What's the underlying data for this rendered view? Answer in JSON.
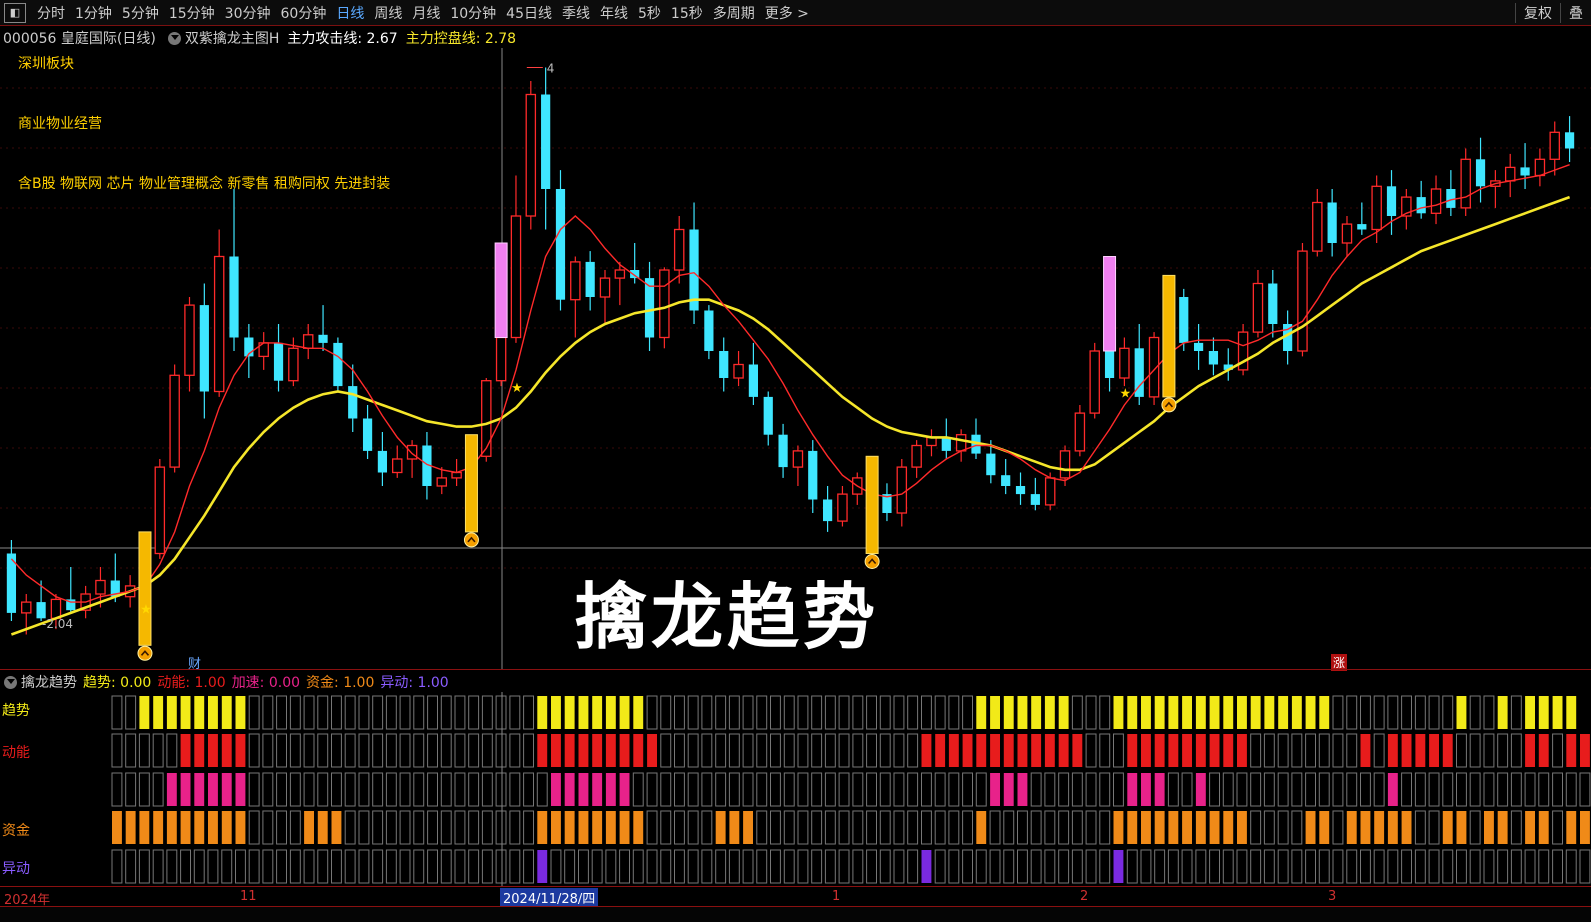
{
  "tabs": {
    "items": [
      "分时",
      "1分钟",
      "5分钟",
      "15分钟",
      "30分钟",
      "60分钟",
      "日线",
      "周线",
      "月线",
      "10分钟",
      "45日线",
      "季线",
      "年线",
      "5秒",
      "15秒",
      "多周期",
      "更多 >"
    ],
    "active_index": 6,
    "right": [
      "复权",
      "叠"
    ]
  },
  "info": {
    "stock": "000056 皇庭国际(日线)",
    "indicator": "双紫擒龙主图H",
    "attack_label": "主力攻击线: 2.67",
    "control_label": "主力控盘线: 2.78"
  },
  "boards": {
    "region": "深圳板块",
    "industry": "商业物业经营",
    "concepts": "含B股 物联网 芯片 物业管理概念 新零售 租购同权 先进封装"
  },
  "chart_labels": {
    "title": "擒龙趋势",
    "high_label": "4",
    "low_label": "-2.04",
    "cai_marker": "财",
    "zhang_marker": "涨"
  },
  "indicator_bar": {
    "name": "擒龙趋势",
    "trend": "趋势: 0.00",
    "momentum": "动能: 1.00",
    "accel": "加速: 0.00",
    "capital": "资金: 1.00",
    "anomaly": "异动: 1.00"
  },
  "rows": {
    "trend": "趋势",
    "momentum": "动能",
    "capital": "资金",
    "anomaly": "异动"
  },
  "dates": {
    "year": "2024年",
    "m11": "11",
    "current": "2024/11/28/四",
    "m1": "1",
    "m2": "2",
    "m3": "3"
  },
  "colors": {
    "up": "#ff2a2a",
    "down": "#3fe6ff",
    "ma_fast": "#ff2a2a",
    "ma_slow": "#f5e62a",
    "trend": "#f2ea18",
    "momentum": "#e81c1c",
    "accel": "#e8228a",
    "capital": "#f08a18",
    "anomaly": "#7a2ae0"
  },
  "chart_data": {
    "type": "candlestick",
    "candles": [
      [
        2.2,
        2.25,
        1.95,
        1.98
      ],
      [
        1.98,
        2.05,
        1.9,
        2.02
      ],
      [
        2.02,
        2.1,
        1.95,
        1.96
      ],
      [
        1.96,
        2.05,
        1.92,
        2.03
      ],
      [
        2.03,
        2.15,
        1.98,
        1.99
      ],
      [
        1.99,
        2.08,
        1.96,
        2.05
      ],
      [
        2.05,
        2.15,
        2.0,
        2.1
      ],
      [
        2.1,
        2.2,
        2.02,
        2.04
      ],
      [
        2.04,
        2.12,
        2.0,
        2.08
      ],
      [
        2.08,
        2.25,
        2.05,
        2.2
      ],
      [
        2.2,
        2.55,
        2.18,
        2.52
      ],
      [
        2.52,
        2.9,
        2.5,
        2.86
      ],
      [
        2.86,
        3.15,
        2.8,
        3.12
      ],
      [
        3.12,
        3.2,
        2.7,
        2.8
      ],
      [
        2.8,
        3.4,
        2.78,
        3.3
      ],
      [
        3.3,
        3.55,
        2.95,
        3.0
      ],
      [
        3.0,
        3.05,
        2.85,
        2.93
      ],
      [
        2.93,
        3.02,
        2.88,
        2.98
      ],
      [
        2.98,
        3.05,
        2.8,
        2.84
      ],
      [
        2.84,
        3.0,
        2.82,
        2.96
      ],
      [
        2.96,
        3.05,
        2.92,
        3.01
      ],
      [
        3.01,
        3.12,
        2.95,
        2.98
      ],
      [
        2.98,
        3.0,
        2.8,
        2.82
      ],
      [
        2.82,
        2.9,
        2.65,
        2.7
      ],
      [
        2.7,
        2.75,
        2.55,
        2.58
      ],
      [
        2.58,
        2.65,
        2.45,
        2.5
      ],
      [
        2.5,
        2.6,
        2.48,
        2.55
      ],
      [
        2.55,
        2.62,
        2.48,
        2.6
      ],
      [
        2.6,
        2.65,
        2.4,
        2.45
      ],
      [
        2.45,
        2.52,
        2.42,
        2.48
      ],
      [
        2.48,
        2.55,
        2.45,
        2.5
      ],
      [
        2.5,
        2.62,
        2.48,
        2.56
      ],
      [
        2.56,
        2.85,
        2.54,
        2.84
      ],
      [
        2.84,
        3.05,
        2.82,
        3.0
      ],
      [
        3.0,
        3.6,
        2.98,
        3.45
      ],
      [
        3.45,
        3.95,
        3.4,
        3.9
      ],
      [
        3.9,
        4.0,
        3.4,
        3.55
      ],
      [
        3.55,
        3.62,
        3.1,
        3.14
      ],
      [
        3.14,
        3.3,
        3.0,
        3.28
      ],
      [
        3.28,
        3.32,
        3.1,
        3.15
      ],
      [
        3.15,
        3.25,
        3.05,
        3.22
      ],
      [
        3.22,
        3.28,
        3.12,
        3.25
      ],
      [
        3.25,
        3.35,
        3.2,
        3.22
      ],
      [
        3.22,
        3.28,
        2.95,
        3.0
      ],
      [
        3.0,
        3.26,
        2.96,
        3.25
      ],
      [
        3.25,
        3.45,
        3.2,
        3.4
      ],
      [
        3.4,
        3.5,
        3.05,
        3.1
      ],
      [
        3.1,
        3.12,
        2.92,
        2.95
      ],
      [
        2.95,
        3.0,
        2.8,
        2.85
      ],
      [
        2.85,
        2.95,
        2.82,
        2.9
      ],
      [
        2.9,
        2.98,
        2.75,
        2.78
      ],
      [
        2.78,
        2.8,
        2.6,
        2.64
      ],
      [
        2.64,
        2.68,
        2.48,
        2.52
      ],
      [
        2.52,
        2.6,
        2.45,
        2.58
      ],
      [
        2.58,
        2.62,
        2.35,
        2.4
      ],
      [
        2.4,
        2.45,
        2.28,
        2.32
      ],
      [
        2.32,
        2.45,
        2.3,
        2.42
      ],
      [
        2.42,
        2.5,
        2.38,
        2.48
      ],
      [
        2.48,
        2.55,
        2.4,
        2.42
      ],
      [
        2.42,
        2.46,
        2.32,
        2.35
      ],
      [
        2.35,
        2.55,
        2.3,
        2.52
      ],
      [
        2.52,
        2.62,
        2.48,
        2.6
      ],
      [
        2.6,
        2.66,
        2.56,
        2.63
      ],
      [
        2.63,
        2.7,
        2.55,
        2.58
      ],
      [
        2.58,
        2.66,
        2.54,
        2.64
      ],
      [
        2.64,
        2.7,
        2.55,
        2.57
      ],
      [
        2.57,
        2.62,
        2.46,
        2.49
      ],
      [
        2.49,
        2.55,
        2.42,
        2.45
      ],
      [
        2.45,
        2.5,
        2.38,
        2.42
      ],
      [
        2.42,
        2.48,
        2.36,
        2.38
      ],
      [
        2.38,
        2.5,
        2.36,
        2.48
      ],
      [
        2.48,
        2.6,
        2.45,
        2.58
      ],
      [
        2.58,
        2.75,
        2.56,
        2.72
      ],
      [
        2.72,
        2.98,
        2.7,
        2.95
      ],
      [
        2.95,
        3.05,
        2.8,
        2.85
      ],
      [
        2.85,
        3.0,
        2.82,
        2.96
      ],
      [
        2.96,
        3.05,
        2.75,
        2.78
      ],
      [
        2.78,
        3.02,
        2.75,
        3.0
      ],
      [
        3.0,
        3.18,
        2.94,
        3.15
      ],
      [
        3.15,
        3.18,
        2.95,
        2.98
      ],
      [
        2.98,
        3.05,
        2.88,
        2.95
      ],
      [
        2.95,
        3.0,
        2.86,
        2.9
      ],
      [
        2.9,
        2.96,
        2.84,
        2.88
      ],
      [
        2.88,
        3.05,
        2.86,
        3.02
      ],
      [
        3.02,
        3.25,
        3.0,
        3.2
      ],
      [
        3.2,
        3.25,
        3.0,
        3.05
      ],
      [
        3.05,
        3.1,
        2.9,
        2.95
      ],
      [
        2.95,
        3.35,
        2.93,
        3.32
      ],
      [
        3.32,
        3.55,
        3.3,
        3.5
      ],
      [
        3.5,
        3.55,
        3.3,
        3.35
      ],
      [
        3.35,
        3.45,
        3.3,
        3.42
      ],
      [
        3.42,
        3.5,
        3.38,
        3.4
      ],
      [
        3.4,
        3.6,
        3.35,
        3.56
      ],
      [
        3.56,
        3.62,
        3.38,
        3.45
      ],
      [
        3.45,
        3.55,
        3.4,
        3.52
      ],
      [
        3.52,
        3.58,
        3.44,
        3.46
      ],
      [
        3.46,
        3.6,
        3.42,
        3.55
      ],
      [
        3.55,
        3.62,
        3.45,
        3.48
      ],
      [
        3.48,
        3.7,
        3.45,
        3.66
      ],
      [
        3.66,
        3.74,
        3.5,
        3.56
      ],
      [
        3.56,
        3.62,
        3.48,
        3.58
      ],
      [
        3.58,
        3.68,
        3.52,
        3.63
      ],
      [
        3.63,
        3.72,
        3.55,
        3.6
      ],
      [
        3.6,
        3.7,
        3.56,
        3.66
      ],
      [
        3.66,
        3.8,
        3.6,
        3.76
      ],
      [
        3.76,
        3.82,
        3.65,
        3.7
      ]
    ],
    "ma_fast": [
      2.18,
      2.12,
      2.08,
      2.04,
      2.02,
      2.02,
      2.04,
      2.05,
      2.06,
      2.08,
      2.16,
      2.28,
      2.45,
      2.58,
      2.74,
      2.86,
      2.94,
      2.98,
      2.98,
      2.97,
      2.96,
      2.96,
      2.93,
      2.88,
      2.8,
      2.71,
      2.63,
      2.57,
      2.53,
      2.51,
      2.5,
      2.52,
      2.59,
      2.7,
      2.88,
      3.1,
      3.3,
      3.4,
      3.45,
      3.4,
      3.33,
      3.27,
      3.23,
      3.19,
      3.19,
      3.23,
      3.24,
      3.19,
      3.12,
      3.06,
      2.99,
      2.92,
      2.83,
      2.73,
      2.64,
      2.56,
      2.49,
      2.45,
      2.42,
      2.41,
      2.42,
      2.46,
      2.51,
      2.55,
      2.58,
      2.6,
      2.6,
      2.58,
      2.55,
      2.51,
      2.48,
      2.47,
      2.5,
      2.58,
      2.66,
      2.75,
      2.82,
      2.88,
      2.94,
      2.98,
      2.99,
      2.99,
      2.99,
      2.97,
      2.99,
      3.02,
      3.03,
      3.06,
      3.14,
      3.23,
      3.3,
      3.36,
      3.39,
      3.43,
      3.46,
      3.48,
      3.49,
      3.51,
      3.52,
      3.55,
      3.57,
      3.58,
      3.59,
      3.6,
      3.62,
      3.64
    ],
    "ma_slow": [
      1.9,
      1.92,
      1.94,
      1.96,
      1.98,
      2.0,
      2.02,
      2.04,
      2.06,
      2.08,
      2.12,
      2.18,
      2.26,
      2.34,
      2.43,
      2.52,
      2.59,
      2.65,
      2.7,
      2.74,
      2.77,
      2.79,
      2.8,
      2.79,
      2.77,
      2.75,
      2.73,
      2.71,
      2.69,
      2.68,
      2.67,
      2.67,
      2.68,
      2.7,
      2.74,
      2.8,
      2.87,
      2.93,
      2.98,
      3.02,
      3.05,
      3.07,
      3.09,
      3.1,
      3.11,
      3.13,
      3.14,
      3.14,
      3.12,
      3.1,
      3.07,
      3.03,
      2.98,
      2.93,
      2.88,
      2.83,
      2.78,
      2.74,
      2.7,
      2.67,
      2.65,
      2.64,
      2.63,
      2.63,
      2.62,
      2.61,
      2.6,
      2.58,
      2.56,
      2.54,
      2.52,
      2.51,
      2.51,
      2.53,
      2.57,
      2.61,
      2.65,
      2.69,
      2.74,
      2.78,
      2.82,
      2.85,
      2.88,
      2.91,
      2.94,
      2.98,
      3.01,
      3.04,
      3.08,
      3.12,
      3.16,
      3.2,
      3.23,
      3.26,
      3.29,
      3.32,
      3.34,
      3.36,
      3.38,
      3.4,
      3.42,
      3.44,
      3.46,
      3.48,
      3.5,
      3.52
    ],
    "ylim": [
      1.85,
      4.05
    ],
    "signals": [
      {
        "index": 9,
        "kind": "buy"
      },
      {
        "index": 31,
        "kind": "buy"
      },
      {
        "index": 33,
        "kind": "pink"
      },
      {
        "index": 58,
        "kind": "buy"
      },
      {
        "index": 74,
        "kind": "pink"
      },
      {
        "index": 78,
        "kind": "buy"
      }
    ],
    "stars": [
      8,
      33,
      74
    ],
    "rows": {
      "trend": [
        0,
        0,
        1,
        1,
        1,
        1,
        1,
        1,
        1,
        1,
        0,
        0,
        0,
        0,
        0,
        0,
        0,
        0,
        0,
        0,
        0,
        0,
        0,
        0,
        0,
        0,
        0,
        0,
        0,
        0,
        0,
        1,
        1,
        1,
        1,
        1,
        1,
        1,
        1,
        0,
        0,
        0,
        0,
        0,
        0,
        0,
        0,
        0,
        0,
        0,
        0,
        0,
        0,
        0,
        0,
        0,
        0,
        0,
        0,
        0,
        0,
        0,
        0,
        1,
        1,
        1,
        1,
        1,
        1,
        1,
        0,
        0,
        0,
        1,
        1,
        1,
        1,
        1,
        1,
        1,
        1,
        1,
        1,
        1,
        1,
        1,
        1,
        1,
        1,
        0,
        0,
        0,
        0,
        0,
        0,
        0,
        0,
        0,
        1,
        0,
        0,
        1,
        0,
        1,
        1,
        1,
        1
      ],
      "momentum": [
        0,
        0,
        0,
        0,
        0,
        1,
        1,
        1,
        1,
        1,
        0,
        0,
        0,
        0,
        0,
        0,
        0,
        0,
        0,
        0,
        0,
        0,
        0,
        0,
        0,
        0,
        0,
        0,
        0,
        0,
        0,
        1,
        1,
        1,
        1,
        1,
        1,
        1,
        1,
        1,
        0,
        0,
        0,
        0,
        0,
        0,
        0,
        0,
        0,
        0,
        0,
        0,
        0,
        0,
        0,
        0,
        0,
        0,
        0,
        1,
        1,
        1,
        1,
        1,
        1,
        1,
        1,
        1,
        1,
        1,
        1,
        0,
        0,
        0,
        1,
        1,
        1,
        1,
        1,
        1,
        1,
        1,
        1,
        0,
        0,
        0,
        0,
        0,
        0,
        0,
        0,
        1,
        0,
        1,
        1,
        1,
        1,
        1,
        0,
        0,
        0,
        0,
        0,
        1,
        1,
        0,
        1,
        1
      ],
      "accel": [
        0,
        0,
        0,
        0,
        1,
        1,
        1,
        1,
        1,
        1,
        0,
        0,
        0,
        0,
        0,
        0,
        0,
        0,
        0,
        0,
        0,
        0,
        0,
        0,
        0,
        0,
        0,
        0,
        0,
        0,
        0,
        0,
        1,
        1,
        1,
        1,
        1,
        1,
        0,
        0,
        0,
        0,
        0,
        0,
        0,
        0,
        0,
        0,
        0,
        0,
        0,
        0,
        0,
        0,
        0,
        0,
        0,
        0,
        0,
        0,
        0,
        0,
        0,
        0,
        1,
        1,
        1,
        0,
        0,
        0,
        0,
        0,
        0,
        0,
        1,
        1,
        1,
        0,
        0,
        1,
        0,
        0,
        0,
        0,
        0,
        0,
        0,
        0,
        0,
        0,
        0,
        0,
        0,
        1,
        0,
        0,
        0,
        0,
        0,
        0,
        0,
        0,
        0,
        0,
        0,
        0,
        0,
        0
      ],
      "capital": [
        1,
        1,
        1,
        1,
        1,
        1,
        1,
        1,
        1,
        1,
        0,
        0,
        0,
        0,
        1,
        1,
        1,
        0,
        0,
        0,
        0,
        0,
        0,
        0,
        0,
        0,
        0,
        0,
        0,
        0,
        0,
        1,
        1,
        1,
        1,
        1,
        1,
        1,
        1,
        0,
        0,
        0,
        0,
        0,
        1,
        1,
        1,
        0,
        0,
        0,
        0,
        0,
        0,
        0,
        0,
        0,
        0,
        0,
        0,
        0,
        0,
        0,
        0,
        1,
        0,
        0,
        0,
        0,
        0,
        0,
        0,
        0,
        0,
        1,
        1,
        1,
        1,
        1,
        1,
        1,
        1,
        1,
        1,
        0,
        0,
        0,
        0,
        1,
        1,
        0,
        1,
        1,
        1,
        1,
        1,
        0,
        0,
        1,
        1,
        0,
        1,
        1,
        0,
        1,
        1,
        0,
        1,
        1
      ],
      "anomaly": [
        0,
        0,
        0,
        0,
        0,
        0,
        0,
        0,
        0,
        0,
        0,
        0,
        0,
        0,
        0,
        0,
        0,
        0,
        0,
        0,
        0,
        0,
        0,
        0,
        0,
        0,
        0,
        0,
        0,
        0,
        0,
        1,
        0,
        0,
        0,
        0,
        0,
        0,
        0,
        0,
        0,
        0,
        0,
        0,
        0,
        0,
        0,
        0,
        0,
        0,
        0,
        0,
        0,
        0,
        0,
        0,
        0,
        0,
        0,
        1,
        0,
        0,
        0,
        0,
        0,
        0,
        0,
        0,
        0,
        0,
        0,
        0,
        0,
        1,
        0,
        0,
        0,
        0,
        0,
        0,
        0,
        0,
        0,
        0,
        0,
        0,
        0,
        0,
        0,
        0,
        0,
        0,
        0,
        0,
        0,
        0,
        0,
        0,
        0,
        0,
        0,
        0,
        0,
        0,
        0,
        0,
        0,
        0
      ]
    }
  }
}
